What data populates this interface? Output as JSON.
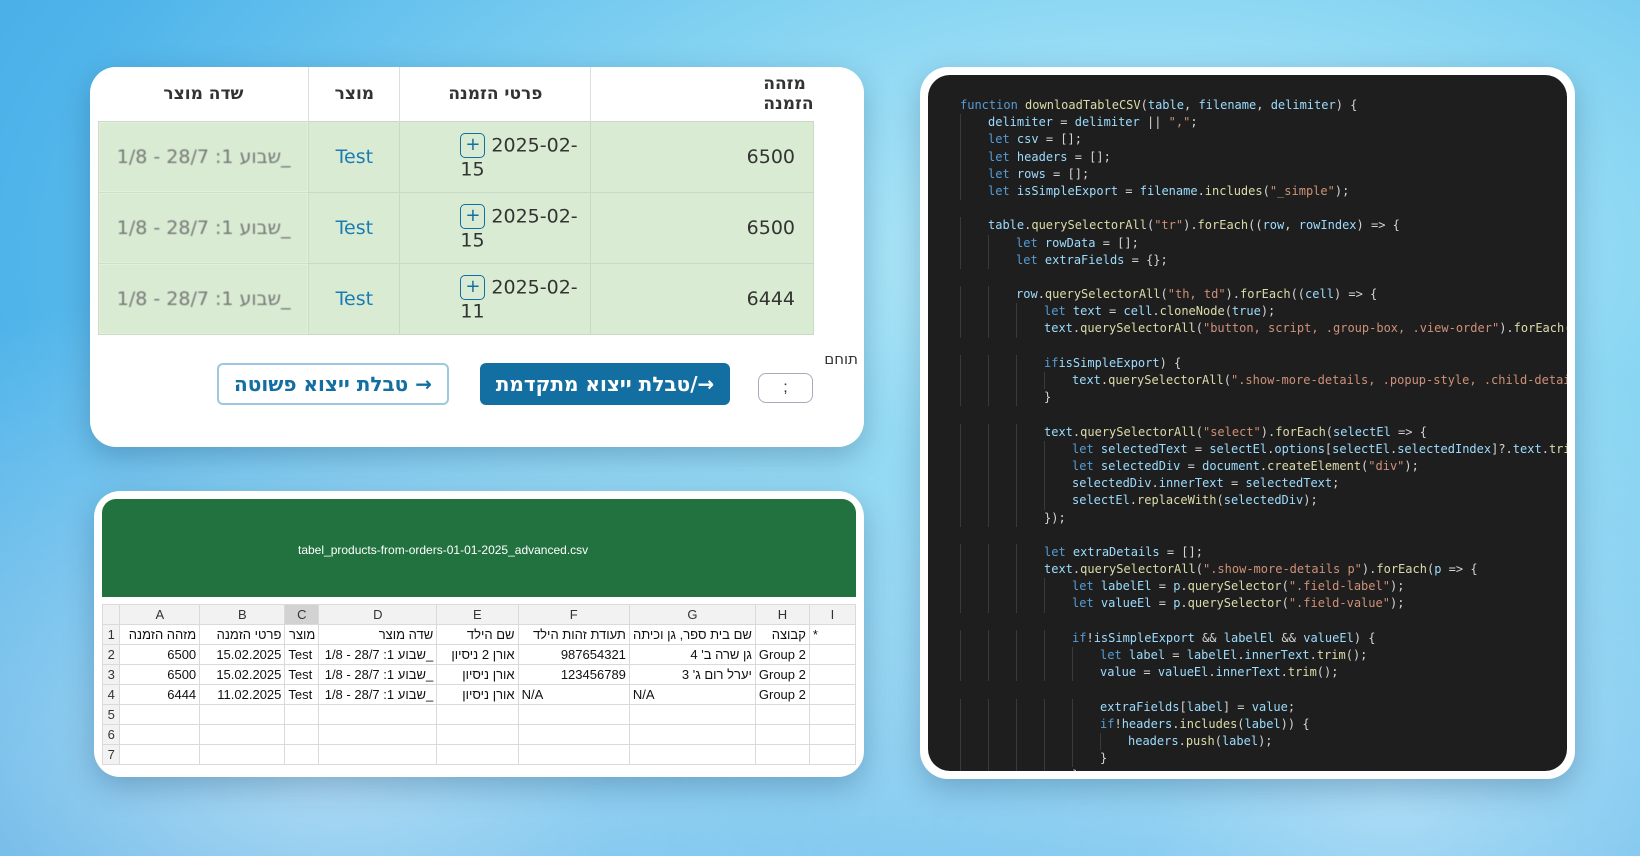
{
  "web_table": {
    "headers": [
      "מזהה הזמנה",
      "פרטי הזמנה",
      "מוצר",
      "שדה מוצר"
    ],
    "rows": [
      {
        "id": "6500",
        "date": "2025-02-15",
        "product": "Test",
        "field": "_שבוע 1: 28/7 - 1/8"
      },
      {
        "id": "6500",
        "date": "2025-02-15",
        "product": "Test",
        "field": "_שבוע 1: 28/7 - 1/8"
      },
      {
        "id": "6444",
        "date": "2025-02-11",
        "product": "Test",
        "field": "_שבוע 1: 28/7 - 1/8"
      }
    ],
    "expand_icon": "+",
    "delimiter_label": "תוחם",
    "delimiter_value": ";",
    "advanced_button": "טבלת ייצוא מתקדמת/→",
    "simple_button": "טבלת ייצוא פשוטה →"
  },
  "spreadsheet": {
    "filename": "tabel_products-from-orders-01-01-2025_advanced.csv",
    "columns": [
      "A",
      "B",
      "C",
      "D",
      "E",
      "F",
      "G",
      "H",
      "I"
    ],
    "row_numbers": [
      "1",
      "2",
      "3",
      "4",
      "5",
      "6",
      "7"
    ],
    "header_row": [
      "מזהה הזמנה",
      "פרטי הזמנה",
      "מוצר",
      "שדה מוצר",
      "שם הילד",
      "תעודת זהות הילד",
      "שם בית ספר, גן וכיתה",
      "קבוצה",
      "*"
    ],
    "data_rows": [
      [
        "6500",
        "15.02.2025",
        "Test",
        "_שבוע 1: 28/7 - 1/8",
        "אורן 2 ניסיון",
        "987654321",
        "גן שרה ב' 4",
        "Group 2",
        ""
      ],
      [
        "6500",
        "15.02.2025",
        "Test",
        "_שבוע 1: 28/7 - 1/8",
        "אורן ניסיון",
        "123456789",
        "יערל רום ג' 3",
        "Group 2",
        ""
      ],
      [
        "6444",
        "11.02.2025",
        "Test",
        "_שבוע 1: 28/7 - 1/8",
        "אורן ניסיון",
        "N/A",
        "N/A",
        "Group 2",
        ""
      ]
    ]
  },
  "code": {
    "lines": [
      "function downloadTableCSV(table, filename, delimiter) {",
      "    delimiter = delimiter || \",\";",
      "    let csv = [];",
      "    let headers = [];",
      "    let rows = [];",
      "    let isSimpleExport = filename.includes(\"_simple\");",
      "",
      "    table.querySelectorAll(\"tr\").forEach((row, rowIndex) => {",
      "        let rowData = [];",
      "        let extraFields = {};",
      "",
      "        row.querySelectorAll(\"th, td\").forEach((cell) => {",
      "            let text = cell.cloneNode(true);",
      "            text.querySelectorAll(\"button, script, .group-box, .view-order\").forEach(el",
      "",
      "            if (isSimpleExport) {",
      "                text.querySelectorAll(\".show-more-details, .popup-style, .child-details",
      "            }",
      "",
      "            text.querySelectorAll(\"select\").forEach(selectEl => {",
      "                let selectedText = selectEl.options[selectEl.selectedIndex]?.text.trim(",
      "                let selectedDiv = document.createElement(\"div\");",
      "                selectedDiv.innerText = selectedText;",
      "                selectEl.replaceWith(selectedDiv);",
      "            });",
      "",
      "            let extraDetails = [];",
      "            text.querySelectorAll(\".show-more-details p\").forEach(p => {",
      "                let labelEl = p.querySelector(\".field-label\");",
      "                let valueEl = p.querySelector(\".field-value\");",
      "",
      "                if (!isSimpleExport && labelEl && valueEl) {",
      "                    let label = labelEl.innerText.trim();",
      "                    value = valueEl.innerText.trim();",
      "",
      "                    extraFields[label] = value;",
      "                    if (!headers.includes(label)) {",
      "                        headers.push(label);",
      "                    }",
      "                }"
    ]
  }
}
